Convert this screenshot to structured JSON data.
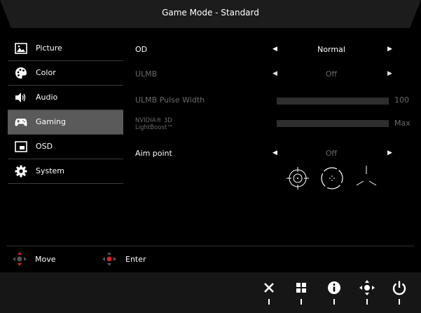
{
  "header": {
    "title": "Game Mode - Standard"
  },
  "sidebar": {
    "items": [
      {
        "label": "Picture",
        "icon": "picture-icon"
      },
      {
        "label": "Color",
        "icon": "palette-icon"
      },
      {
        "label": "Audio",
        "icon": "speaker-icon"
      },
      {
        "label": "Gaming",
        "icon": "gamepad-icon",
        "active": true
      },
      {
        "label": "OSD",
        "icon": "osd-icon"
      },
      {
        "label": "System",
        "icon": "gear-icon"
      }
    ]
  },
  "settings": {
    "od": {
      "label": "OD",
      "value": "Normal"
    },
    "ulmb": {
      "label": "ULMB",
      "value": "Off"
    },
    "ulmb_pulse": {
      "label": "ULMB Pulse Width",
      "value": "100"
    },
    "lightboost": {
      "label_line1": "NVIDIA® 3D",
      "label_line2": "LightBoost™",
      "value": "Max"
    },
    "aim_point": {
      "label": "Aim point",
      "value": "Off"
    }
  },
  "footer": {
    "move_label": "Move",
    "enter_label": "Enter"
  },
  "bottom_buttons": [
    "close-icon",
    "menu-grid-icon",
    "info-icon",
    "navigate-icon",
    "power-icon"
  ],
  "colors": {
    "background": "#000000",
    "active_item": "#5a5a5a",
    "dim_text": "#6a6a6a",
    "accent_red": "#e0201e"
  }
}
